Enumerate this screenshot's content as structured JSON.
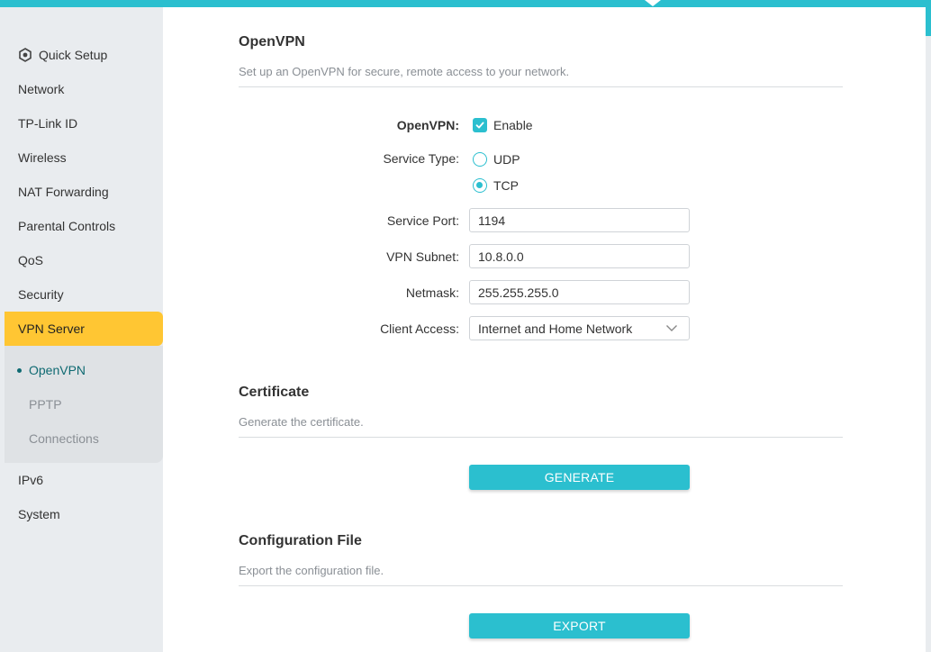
{
  "sidebar": {
    "items": [
      {
        "label": "Quick Setup",
        "icon": "gear-icon"
      },
      {
        "label": "Network"
      },
      {
        "label": "TP-Link ID"
      },
      {
        "label": "Wireless"
      },
      {
        "label": "NAT Forwarding"
      },
      {
        "label": "Parental Controls"
      },
      {
        "label": "QoS"
      },
      {
        "label": "Security"
      },
      {
        "label": "VPN Server",
        "active": true
      },
      {
        "label": "IPv6"
      },
      {
        "label": "System"
      }
    ],
    "subitems": [
      {
        "label": "OpenVPN",
        "current": true
      },
      {
        "label": "PPTP"
      },
      {
        "label": "Connections"
      }
    ]
  },
  "openvpn_section": {
    "title": "OpenVPN",
    "description": "Set up an OpenVPN for secure, remote access to your network.",
    "fields": {
      "openvpn": {
        "label": "OpenVPN:",
        "option_label": "Enable",
        "checked": true
      },
      "service_type": {
        "label": "Service Type:",
        "options": [
          "UDP",
          "TCP"
        ],
        "selected": "TCP"
      },
      "service_port": {
        "label": "Service Port:",
        "value": "1194"
      },
      "vpn_subnet": {
        "label": "VPN Subnet:",
        "value": "10.8.0.0"
      },
      "netmask": {
        "label": "Netmask:",
        "value": "255.255.255.0"
      },
      "client_access": {
        "label": "Client Access:",
        "value": "Internet and Home Network"
      }
    }
  },
  "certificate_section": {
    "title": "Certificate",
    "description": "Generate the certificate.",
    "button_label": "GENERATE"
  },
  "config_section": {
    "title": "Configuration File",
    "description": "Export the configuration file.",
    "button_label": "EXPORT"
  },
  "colors": {
    "accent": "#2bbfcf",
    "active_nav": "#ffc633",
    "subnav_text": "#0f6a72"
  }
}
